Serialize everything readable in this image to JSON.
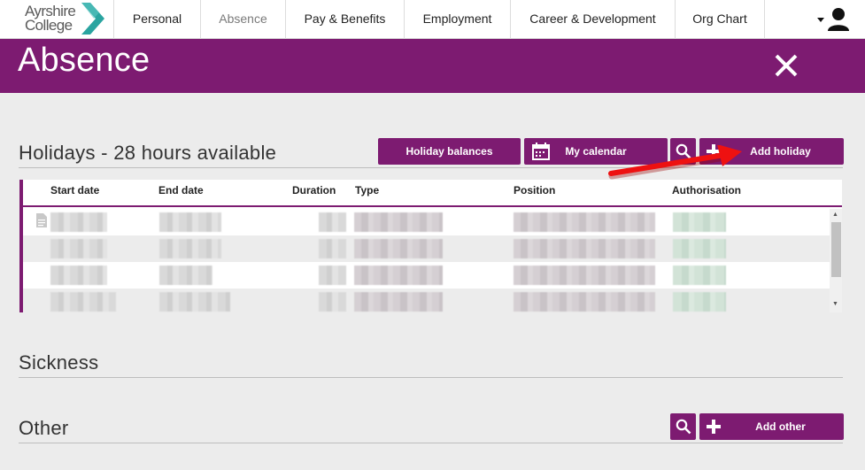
{
  "logo": {
    "line1": "Ayrshire",
    "line2": "College"
  },
  "nav": {
    "tabs": [
      {
        "label": "Personal"
      },
      {
        "label": "Absence"
      },
      {
        "label": "Pay & Benefits"
      },
      {
        "label": "Employment"
      },
      {
        "label": "Career & Development"
      },
      {
        "label": "Org Chart"
      }
    ],
    "active_index": 1,
    "user_icon": "user-icon"
  },
  "header": {
    "title": "Absence",
    "close_icon": "close-icon"
  },
  "colors": {
    "brand": "#7d1b71",
    "highlight": "#ff0000"
  },
  "holidays": {
    "title": "Holidays - 28 hours available",
    "buttons": {
      "balances": "Holiday balances",
      "calendar": "My calendar",
      "add": "Add holiday"
    },
    "columns": [
      "Start date",
      "End date",
      "Duration",
      "Type",
      "Position",
      "Authorisation"
    ]
  },
  "sickness": {
    "title": "Sickness"
  },
  "other": {
    "title": "Other",
    "add": "Add other"
  }
}
